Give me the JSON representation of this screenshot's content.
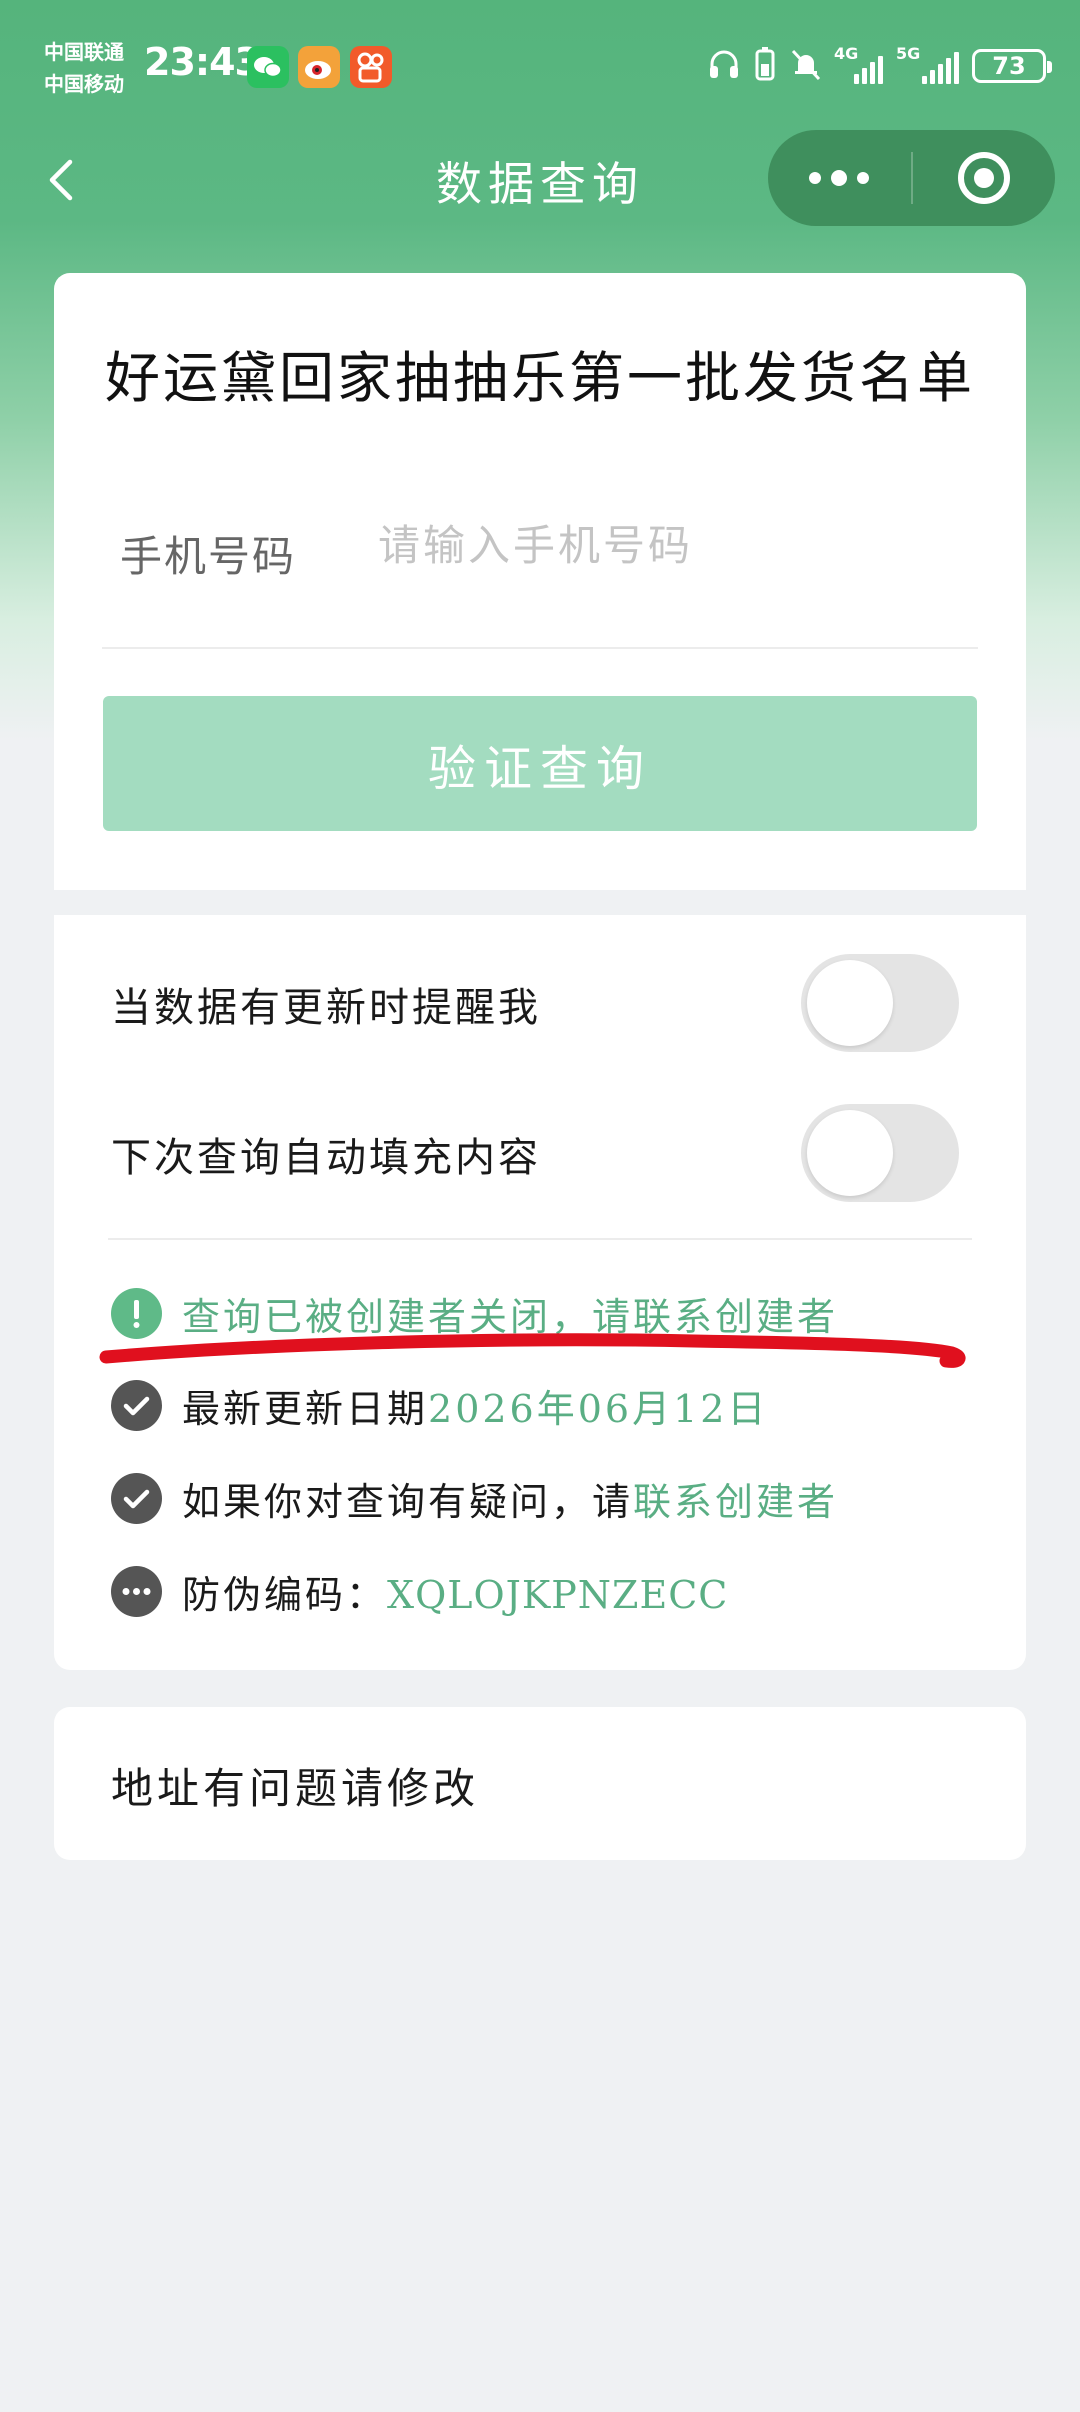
{
  "status_bar": {
    "carrier1": "中国联通",
    "carrier2": "中国移动",
    "time": "23:43",
    "app_icons": [
      "wechat-icon",
      "weibo-icon",
      "kuaishou-icon"
    ],
    "network1": "4G",
    "network2": "5G",
    "battery": "73"
  },
  "nav": {
    "title": "数据查询"
  },
  "form": {
    "title": "好运黛回家抽抽乐第一批发货名单",
    "phone_label": "手机号码",
    "phone_placeholder": "请输入手机号码",
    "phone_value": "",
    "verify_button": "验证查询"
  },
  "options": {
    "remind_label": "当数据有更新时提醒我",
    "remind_on": false,
    "autofill_label": "下次查询自动填充内容",
    "autofill_on": false
  },
  "info": {
    "closed_notice": "查询已被创建者关闭，请联系创建者",
    "update_prefix": "最新更新日期",
    "update_date": "2026年06月12日",
    "question_prefix": "如果你对查询有疑问，请",
    "question_link": "联系创建者",
    "code_prefix": "防伪编码：",
    "code_value": "XQLOJKPNZECC"
  },
  "address": {
    "label": "地址有问题请修改"
  },
  "colors": {
    "brand_green": "#55b47c",
    "accent_green": "#5aae84",
    "button_disabled": "#a3dcc0",
    "annotation_red": "#e0101e"
  }
}
